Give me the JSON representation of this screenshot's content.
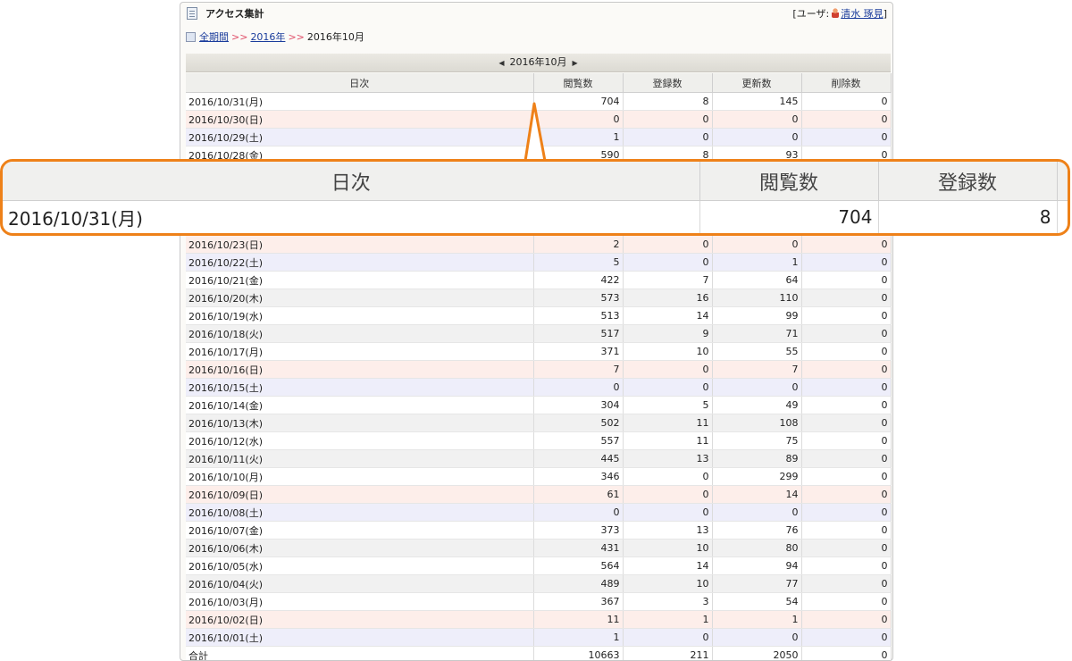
{
  "window": {
    "title": "アクセス集計",
    "user_prefix": "[ユーザ:",
    "user_name": "清水 琢見",
    "user_suffix": "]"
  },
  "breadcrumb": {
    "all": "全期間",
    "year": "2016年",
    "sep1": ">>",
    "sep2": ">>",
    "current": "2016年10月"
  },
  "month_nav": {
    "label": "2016年10月",
    "prev_icon": "triangle-left-icon",
    "next_icon": "triangle-right-icon"
  },
  "table": {
    "headers": [
      "日次",
      "閲覧数",
      "登録数",
      "更新数",
      "削除数"
    ],
    "rows": [
      {
        "date": "2016/10/31(月)",
        "views": "704",
        "reg": "8",
        "upd": "145",
        "del": "0",
        "type": "wd"
      },
      {
        "date": "2016/10/30(日)",
        "views": "0",
        "reg": "0",
        "upd": "0",
        "del": "0",
        "type": "sun"
      },
      {
        "date": "2016/10/29(土)",
        "views": "1",
        "reg": "0",
        "upd": "0",
        "del": "0",
        "type": "sat"
      },
      {
        "date": "2016/10/28(金)",
        "views": "590",
        "reg": "8",
        "upd": "93",
        "del": "0",
        "type": "wd"
      },
      {
        "date": "",
        "views": "",
        "reg": "",
        "upd": "",
        "del": "",
        "type": "wd-alt"
      },
      {
        "date": "",
        "views": "",
        "reg": "",
        "upd": "",
        "del": "",
        "type": "wd"
      },
      {
        "date": "",
        "views": "",
        "reg": "",
        "upd": "",
        "del": "",
        "type": "wd-alt"
      },
      {
        "date": "",
        "views": "",
        "reg": "",
        "upd": "",
        "del": "",
        "type": "wd"
      },
      {
        "date": "2016/10/23(日)",
        "views": "2",
        "reg": "0",
        "upd": "0",
        "del": "0",
        "type": "sun"
      },
      {
        "date": "2016/10/22(土)",
        "views": "5",
        "reg": "0",
        "upd": "1",
        "del": "0",
        "type": "sat"
      },
      {
        "date": "2016/10/21(金)",
        "views": "422",
        "reg": "7",
        "upd": "64",
        "del": "0",
        "type": "wd"
      },
      {
        "date": "2016/10/20(木)",
        "views": "573",
        "reg": "16",
        "upd": "110",
        "del": "0",
        "type": "wd-alt"
      },
      {
        "date": "2016/10/19(水)",
        "views": "513",
        "reg": "14",
        "upd": "99",
        "del": "0",
        "type": "wd"
      },
      {
        "date": "2016/10/18(火)",
        "views": "517",
        "reg": "9",
        "upd": "71",
        "del": "0",
        "type": "wd-alt"
      },
      {
        "date": "2016/10/17(月)",
        "views": "371",
        "reg": "10",
        "upd": "55",
        "del": "0",
        "type": "wd"
      },
      {
        "date": "2016/10/16(日)",
        "views": "7",
        "reg": "0",
        "upd": "7",
        "del": "0",
        "type": "sun"
      },
      {
        "date": "2016/10/15(土)",
        "views": "0",
        "reg": "0",
        "upd": "0",
        "del": "0",
        "type": "sat"
      },
      {
        "date": "2016/10/14(金)",
        "views": "304",
        "reg": "5",
        "upd": "49",
        "del": "0",
        "type": "wd"
      },
      {
        "date": "2016/10/13(木)",
        "views": "502",
        "reg": "11",
        "upd": "108",
        "del": "0",
        "type": "wd-alt"
      },
      {
        "date": "2016/10/12(水)",
        "views": "557",
        "reg": "11",
        "upd": "75",
        "del": "0",
        "type": "wd"
      },
      {
        "date": "2016/10/11(火)",
        "views": "445",
        "reg": "13",
        "upd": "89",
        "del": "0",
        "type": "wd-alt"
      },
      {
        "date": "2016/10/10(月)",
        "views": "346",
        "reg": "0",
        "upd": "299",
        "del": "0",
        "type": "wd"
      },
      {
        "date": "2016/10/09(日)",
        "views": "61",
        "reg": "0",
        "upd": "14",
        "del": "0",
        "type": "sun"
      },
      {
        "date": "2016/10/08(土)",
        "views": "0",
        "reg": "0",
        "upd": "0",
        "del": "0",
        "type": "sat"
      },
      {
        "date": "2016/10/07(金)",
        "views": "373",
        "reg": "13",
        "upd": "76",
        "del": "0",
        "type": "wd"
      },
      {
        "date": "2016/10/06(木)",
        "views": "431",
        "reg": "10",
        "upd": "80",
        "del": "0",
        "type": "wd-alt"
      },
      {
        "date": "2016/10/05(水)",
        "views": "564",
        "reg": "14",
        "upd": "94",
        "del": "0",
        "type": "wd"
      },
      {
        "date": "2016/10/04(火)",
        "views": "489",
        "reg": "10",
        "upd": "77",
        "del": "0",
        "type": "wd-alt"
      },
      {
        "date": "2016/10/03(月)",
        "views": "367",
        "reg": "3",
        "upd": "54",
        "del": "0",
        "type": "wd"
      },
      {
        "date": "2016/10/02(日)",
        "views": "11",
        "reg": "1",
        "upd": "1",
        "del": "0",
        "type": "sun"
      },
      {
        "date": "2016/10/01(土)",
        "views": "1",
        "reg": "0",
        "upd": "0",
        "del": "0",
        "type": "sat"
      }
    ],
    "total": {
      "label": "合計",
      "views": "10663",
      "reg": "211",
      "upd": "2050",
      "del": "0"
    }
  },
  "callout": {
    "headers": [
      "日次",
      "閲覧数",
      "登録数"
    ],
    "row": {
      "date": "2016/10/31(月)",
      "views": "704",
      "reg": "8"
    },
    "color": "#ee8119"
  },
  "colors": {
    "sunday_row": "#fdeeea",
    "saturday_row": "#eeeefa",
    "link": "#1a3c9c",
    "breadcrumb_sep": "#e0506a"
  }
}
